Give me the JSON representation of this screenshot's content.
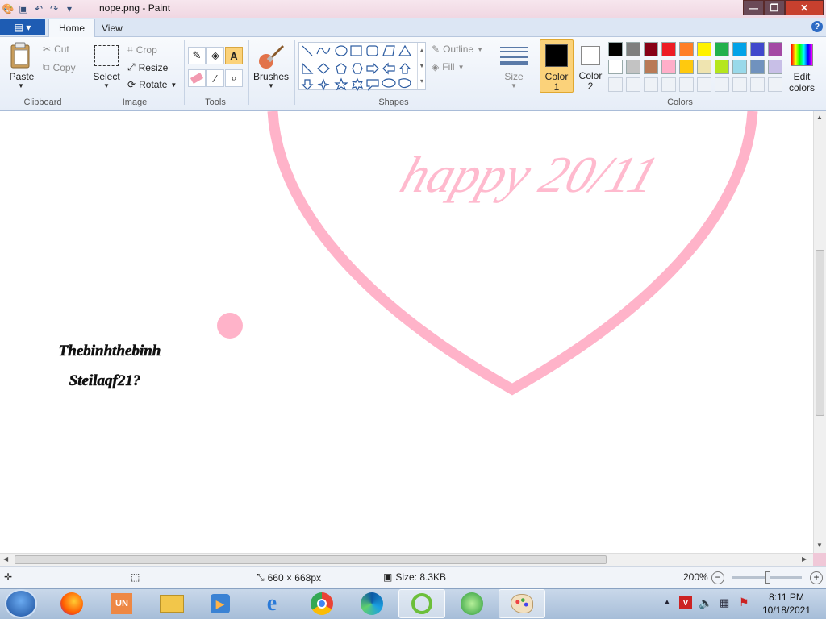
{
  "titlebar": {
    "title": "nope.png - Paint",
    "minimize": "—",
    "maximize": "❐",
    "close": "✕"
  },
  "menu": {
    "file_glyph": "▤ ▾",
    "tabs": [
      "Home",
      "View"
    ],
    "help": "?"
  },
  "ribbon": {
    "clipboard": {
      "label": "Clipboard",
      "paste": "Paste",
      "cut": "Cut",
      "copy": "Copy"
    },
    "image": {
      "label": "Image",
      "select": "Select",
      "crop": "Crop",
      "resize": "Resize",
      "rotate": "Rotate"
    },
    "tools": {
      "label": "Tools"
    },
    "brushes": {
      "label": "Brushes"
    },
    "shapes": {
      "label": "Shapes",
      "outline": "Outline",
      "fill": "Fill"
    },
    "size": {
      "label": "Size"
    },
    "colors": {
      "label": "Colors",
      "color1": "Color",
      "color1_num": "1",
      "color2": "Color",
      "color2_num": "2",
      "edit_colors_1": "Edit",
      "edit_colors_2": "colors",
      "color1_value": "#000000",
      "color2_value": "#ffffff",
      "palette_row1": [
        "#000000",
        "#7f7f7f",
        "#880015",
        "#ed1c24",
        "#ff7f27",
        "#fff200",
        "#22b14c",
        "#00a2e8",
        "#3f48cc",
        "#a349a4"
      ],
      "palette_row2": [
        "#ffffff",
        "#c3c3c3",
        "#b97a57",
        "#ffaec9",
        "#ffc90e",
        "#efe4b0",
        "#b5e61d",
        "#99d9ea",
        "#7092be",
        "#c8bfe7"
      ]
    }
  },
  "canvas": {
    "heart_text": "happy 20/11",
    "signature_line1": "Thebinhthebinh",
    "signature_line2": "Steilaqf21?",
    "heart_color": "#ffb3c9"
  },
  "status": {
    "dimensions": "660 × 668px",
    "size": "Size: 8.3KB",
    "zoom": "200%",
    "zoom_level": 0.5
  },
  "taskbar": {
    "time": "8:11 PM",
    "date": "10/18/2021"
  }
}
